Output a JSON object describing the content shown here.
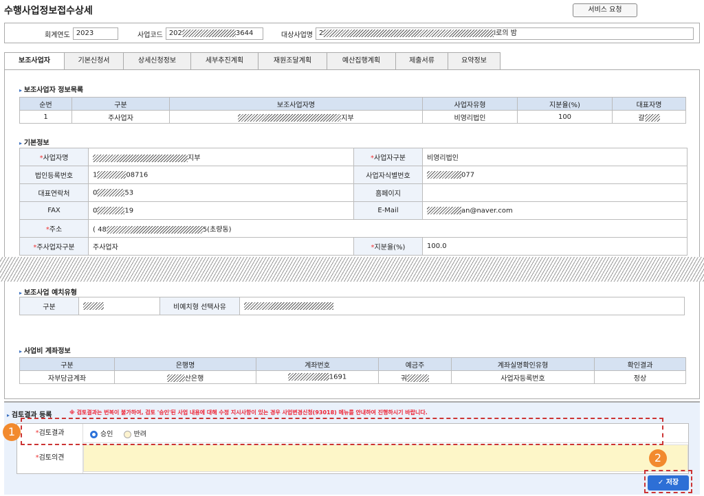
{
  "title": "수행사업정보접수상세",
  "service_request": "서비스 요청",
  "header": {
    "year_label": "회계연도",
    "year_value": "2023",
    "code_label": "사업코드",
    "code_prefix": "202",
    "code_suffix": "3644",
    "biz_label": "대상사업명",
    "biz_prefix": "2",
    "biz_suffix": "l로의 밤"
  },
  "tabs": [
    "보조사업자",
    "기본신청서",
    "상세신청정보",
    "세부추진계획",
    "재원조달계획",
    "예산집행계획",
    "제출서류",
    "요약정보"
  ],
  "list_section": {
    "title": "보조사업자 정보목록",
    "headers": [
      "순번",
      "구분",
      "보조사업자명",
      "사업자유형",
      "지분율(%)",
      "대표자명"
    ],
    "row": {
      "no": "1",
      "type": "주사업자",
      "name_suffix": "지부",
      "biz_type": "비영리법인",
      "ratio": "100",
      "rep_prefix": "갈"
    }
  },
  "basic": {
    "title": "기본정보",
    "name_label": "사업자명",
    "name_suffix": "지부",
    "category_label": "사업자구분",
    "category_value": "비영리법인",
    "corp_label": "법인등록번호",
    "corp_prefix": "1",
    "corp_suffix": "08716",
    "bizno_label": "사업자식별번호",
    "bizno_suffix": "077",
    "phone_label": "대표연락처",
    "phone_prefix": "0",
    "phone_suffix": "53",
    "homepage_label": "홈페이지",
    "fax_label": "FAX",
    "fax_prefix": "0",
    "fax_suffix": "19",
    "email_label": "E-Mail",
    "email_suffix": "an@naver.com",
    "addr_label": "주소",
    "addr_prefix": "(  48",
    "addr_suffix": "5(초량동)",
    "main_label": "주사업자구분",
    "main_value": "주사업자",
    "share_label": "지분율(%)",
    "share_value": "100.0"
  },
  "exec": {
    "title": "보조사업 예치유형",
    "cat_label": "구분",
    "reason_label": "비예치형 선택사유"
  },
  "account": {
    "title": "사업비 계좌정보",
    "headers": [
      "구분",
      "은행명",
      "계좌번호",
      "예금주",
      "계좌실명확인유형",
      "확인결과"
    ],
    "row": {
      "type": "자부담금계좌",
      "bank_suffix": "산은행",
      "acct_suffix": "1691",
      "owner_prefix": "궈",
      "verify_type": "사업자등록번호",
      "result": "정상"
    }
  },
  "review": {
    "title": "검토결과 등록",
    "notice": "※ 검토결과는 번복이 불가하여, 검토 '승인'된 사업 내용에 대해 수정 지시사항이 있는 경우 사업변경신청(93018) 메뉴를 안내하여 진행하시기 바랍니다.",
    "result_label": "검토결과",
    "approve": "승인",
    "reject": "반려",
    "opinion_label": "검토의견",
    "save": "저장"
  },
  "markers": [
    "1",
    "2"
  ]
}
